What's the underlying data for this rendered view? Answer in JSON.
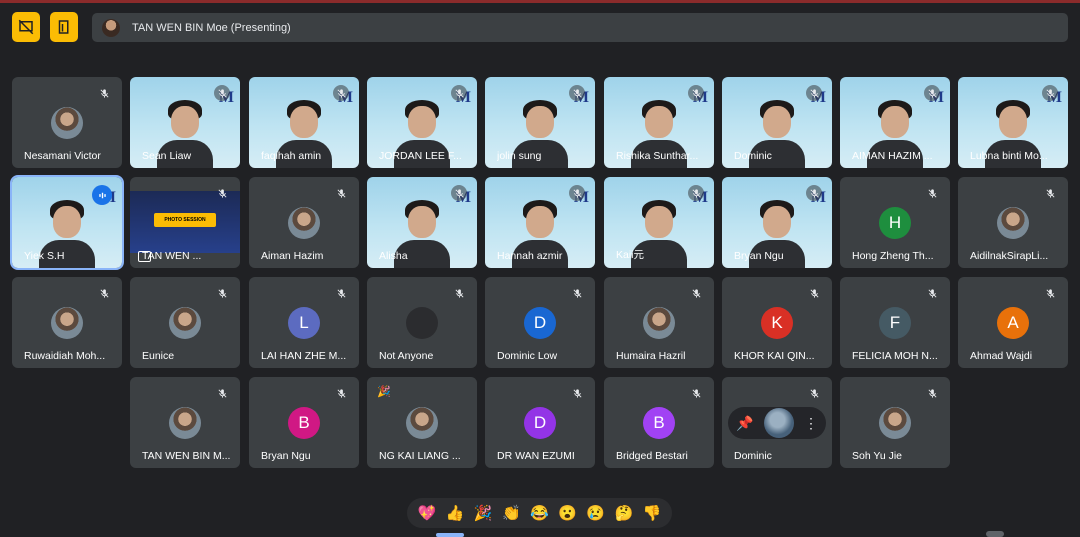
{
  "toolbar": {
    "present_button": "presentation-off-icon",
    "exit_button": "door-exit-icon"
  },
  "presenting_bar": {
    "label": "TAN WEN BIN Moe (Presenting)"
  },
  "colors": {
    "accent": "#fbbc04",
    "tile": "#3c4043",
    "background": "#202124",
    "active_speaker": "#8ab4f8"
  },
  "participants": [
    {
      "name": "Nesamani Victor",
      "type": "photo"
    },
    {
      "name": "Sean Liaw",
      "type": "video"
    },
    {
      "name": "faqihah amin",
      "type": "video"
    },
    {
      "name": "JORDAN LEE F...",
      "type": "video"
    },
    {
      "name": "jolin sung",
      "type": "video"
    },
    {
      "name": "Rishika Sunthar...",
      "type": "video"
    },
    {
      "name": "Dominic",
      "type": "video"
    },
    {
      "name": "AIMAN HAZIM ...",
      "type": "video"
    },
    {
      "name": "Lubna binti Mo...",
      "type": "video"
    },
    {
      "name": "Yiek S.H",
      "type": "video",
      "speaking": true
    },
    {
      "name": "TAN WEN ...",
      "type": "screen",
      "banner": "PHOTO SESSION"
    },
    {
      "name": "Aiman Hazim",
      "type": "photo"
    },
    {
      "name": "Alisha",
      "type": "video"
    },
    {
      "name": "Hannah azmir",
      "type": "video"
    },
    {
      "name": "Kaii元",
      "type": "video"
    },
    {
      "name": "Bryan Ngu",
      "type": "video"
    },
    {
      "name": "Hong Zheng Th...",
      "type": "letter",
      "letter": "H",
      "color": "#1e8e3e"
    },
    {
      "name": "AidilnakSirapLi...",
      "type": "photo"
    },
    {
      "name": "Ruwaidiah Moh...",
      "type": "photo"
    },
    {
      "name": "Eunice",
      "type": "photo"
    },
    {
      "name": "LAI HAN ZHE M...",
      "type": "letter",
      "letter": "L",
      "color": "#5c6bc0"
    },
    {
      "name": "Not Anyone",
      "type": "blank"
    },
    {
      "name": "Dominic Low",
      "type": "letter",
      "letter": "D",
      "color": "#1967d2"
    },
    {
      "name": "Humaira Hazril",
      "type": "photo"
    },
    {
      "name": "KHOR KAI QIN...",
      "type": "letter",
      "letter": "K",
      "color": "#d93025"
    },
    {
      "name": "FELICIA MOH N...",
      "type": "letter",
      "letter": "F",
      "color": "#455a64"
    },
    {
      "name": "Ahmad Wajdi",
      "type": "letter",
      "letter": "A",
      "color": "#e8710a"
    },
    {
      "name": "TAN WEN BIN M...",
      "type": "photo"
    },
    {
      "name": "Bryan Ngu",
      "type": "letter",
      "letter": "B",
      "color": "#d01884"
    },
    {
      "name": "NG KAI LIANG ...",
      "type": "photo",
      "reaction": "🎉"
    },
    {
      "name": "DR WAN EZUMI",
      "type": "letter",
      "letter": "D",
      "color": "#9334e6"
    },
    {
      "name": "Bridged Bestari",
      "type": "letter",
      "letter": "B",
      "color": "#a142f4"
    },
    {
      "name": "Dominic",
      "type": "pinned"
    },
    {
      "name": "Soh Yu Jie",
      "type": "photo"
    }
  ],
  "reactions": [
    "💖",
    "👍",
    "🎉",
    "👏",
    "😂",
    "😮",
    "😢",
    "🤔",
    "👎"
  ]
}
